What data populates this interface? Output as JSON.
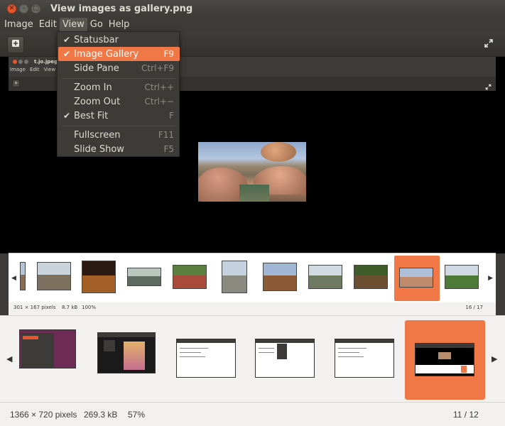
{
  "window": {
    "title": "View images as gallery.png"
  },
  "menubar": {
    "items": [
      {
        "label": "Image"
      },
      {
        "label": "Edit"
      },
      {
        "label": "View"
      },
      {
        "label": "Go"
      },
      {
        "label": "Help"
      }
    ],
    "active": "View"
  },
  "view_menu": {
    "items": [
      {
        "label": "Statusbar",
        "checked": true,
        "accel": ""
      },
      {
        "label": "Image Gallery",
        "checked": true,
        "accel": "F9",
        "highlighted": true
      },
      {
        "label": "Side Pane",
        "checked": false,
        "accel": "Ctrl+F9"
      },
      {
        "label": "Zoom In",
        "checked": false,
        "accel": "Ctrl++"
      },
      {
        "label": "Zoom Out",
        "checked": false,
        "accel": "Ctrl+−"
      },
      {
        "label": "Best Fit",
        "checked": true,
        "accel": "F"
      },
      {
        "label": "Fullscreen",
        "checked": false,
        "accel": "F11"
      },
      {
        "label": "Slide Show",
        "checked": false,
        "accel": "F5"
      }
    ],
    "check_glyph": "✔"
  },
  "toolbar": {
    "add_icon": "plus-square-icon",
    "fullscreen_icon": "expand-icon"
  },
  "nested_window": {
    "title": "t.jo.jpeg",
    "menus": [
      {
        "label": "Image"
      },
      {
        "label": "Edit"
      },
      {
        "label": "View"
      }
    ]
  },
  "inner_status": {
    "dimensions": "301 × 167 pixels",
    "size": "8.7 kB",
    "zoom": "100%",
    "position": "16 / 17"
  },
  "status": {
    "dimensions": "1366 × 720 pixels",
    "size": "269.3 kB",
    "zoom": "57%",
    "position": "11 / 12"
  },
  "colors": {
    "accent": "#f07746",
    "titlebar": "#3c3b37",
    "image_background": "#000000",
    "gallery_background": "#f2f1f0"
  }
}
